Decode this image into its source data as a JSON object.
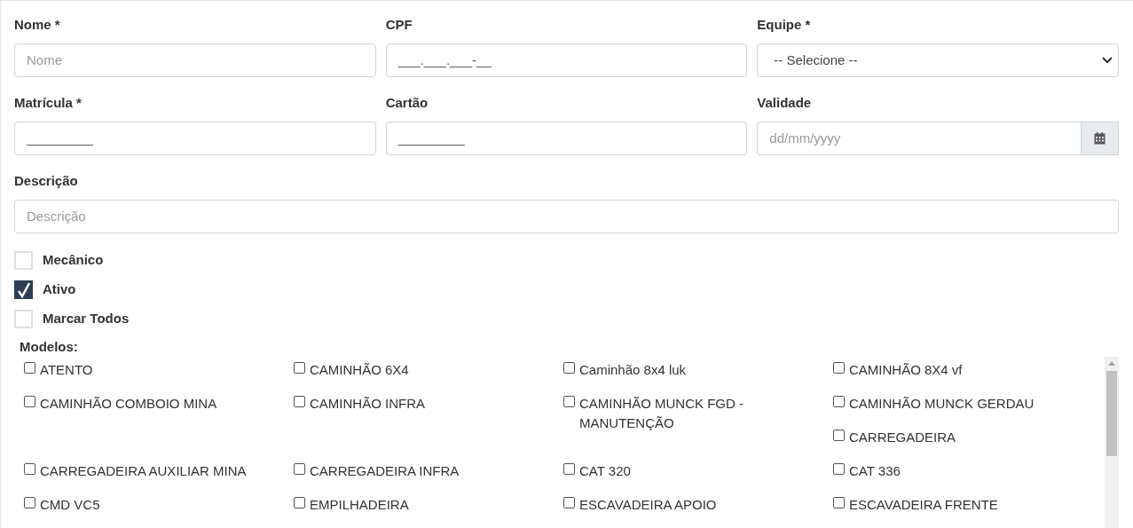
{
  "fields_row1": [
    {
      "label": "Nome *",
      "kind": "text",
      "placeholder": "Nome"
    },
    {
      "label": "CPF",
      "kind": "text",
      "value": "___.___.___-__"
    },
    {
      "label": "Equipe *",
      "kind": "select",
      "value": "-- Selecione --"
    }
  ],
  "fields_row2": [
    {
      "label": "Matrícula *",
      "kind": "text",
      "value": "_________"
    },
    {
      "label": "Cartão",
      "kind": "text",
      "value": "_________"
    },
    {
      "label": "Validade",
      "kind": "date",
      "placeholder": "dd/mm/yyyy"
    }
  ],
  "description": {
    "label": "Descrição",
    "placeholder": "Descrição"
  },
  "toggles": [
    {
      "label": "Mecânico",
      "checked": false
    },
    {
      "label": "Ativo",
      "checked": true
    },
    {
      "label": "Marcar Todos",
      "checked": false
    }
  ],
  "models": {
    "label": "Modelos:",
    "items": [
      {
        "label": "ATENTO",
        "checked": false
      },
      {
        "label": "CAMINHÃO 6X4",
        "checked": false
      },
      {
        "label": "Caminhão 8x4 luk",
        "checked": false
      },
      {
        "label": "CAMINHÃO 8X4 vf",
        "checked": false
      },
      {
        "label": "CAMINHÃO COMBOIO MINA",
        "checked": false
      },
      {
        "label": "CAMINHÃO INFRA",
        "checked": false
      },
      {
        "label": "CAMINHÃO MUNCK FGD - MANUTENÇÃO",
        "checked": false
      },
      {
        "label": "CAMINHÃO MUNCK GERDAU",
        "checked": false
      },
      {
        "label": "CARREGADEIRA",
        "checked": false
      },
      {
        "label": "CARREGADEIRA AUXILIAR MINA",
        "checked": false
      },
      {
        "label": "CARREGADEIRA INFRA",
        "checked": false
      },
      {
        "label": "CAT 320",
        "checked": false
      },
      {
        "label": "CAT 336",
        "checked": false
      },
      {
        "label": "CMD VC5",
        "checked": false
      },
      {
        "label": "EMPILHADEIRA",
        "checked": false
      },
      {
        "label": "ESCAVADEIRA APOIO",
        "checked": false
      },
      {
        "label": "ESCAVADEIRA FRENTE",
        "checked": false
      }
    ]
  }
}
